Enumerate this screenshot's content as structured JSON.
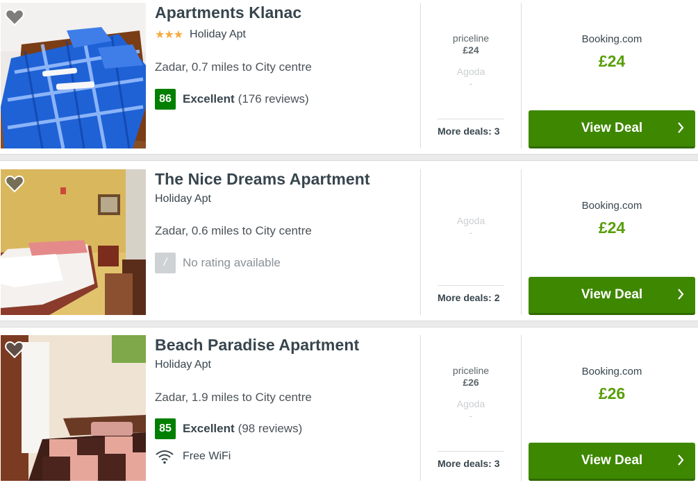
{
  "listings": [
    {
      "name": "Apartments Klanac",
      "stars": "★★★",
      "type": "Holiday Apt",
      "location": "Zadar, 0.7 miles to City centre",
      "rating": {
        "score": "86",
        "word": "Excellent",
        "count": "(176 reviews)"
      },
      "deals": [
        {
          "name": "priceline",
          "price": "£24",
          "muted": false
        },
        {
          "name": "Agoda",
          "price": "-",
          "muted": true
        }
      ],
      "more_deals": "More deals: 3",
      "best_provider": "Booking.com",
      "best_price": "£24",
      "button": "View Deal"
    },
    {
      "name": "The Nice Dreams Apartment",
      "stars": "",
      "type": "Holiday Apt",
      "location": "Zadar, 0.6 miles to City centre",
      "no_rating": {
        "badge": "/",
        "text": "No rating available"
      },
      "deals": [
        {
          "name": "Agoda",
          "price": "-",
          "muted": true
        }
      ],
      "more_deals": "More deals: 2",
      "best_provider": "Booking.com",
      "best_price": "£24",
      "button": "View Deal"
    },
    {
      "name": "Beach Paradise Apartment",
      "stars": "",
      "type": "Holiday Apt",
      "location": "Zadar, 1.9 miles to City centre",
      "rating": {
        "score": "85",
        "word": "Excellent",
        "count": "(98 reviews)"
      },
      "amenity": "Free WiFi",
      "deals": [
        {
          "name": "priceline",
          "price": "£26",
          "muted": false
        },
        {
          "name": "Agoda",
          "price": "-",
          "muted": true
        }
      ],
      "more_deals": "More deals: 3",
      "best_provider": "Booking.com",
      "best_price": "£26",
      "button": "View Deal"
    }
  ],
  "icons": {
    "favorite": "heart-icon",
    "wifi": "wifi-icon",
    "chevron": "chevron-right-icon"
  },
  "colors": {
    "button": "#3e8700",
    "price": "#589e0a",
    "rating": "#007f00",
    "stars": "#f6ab3f"
  }
}
